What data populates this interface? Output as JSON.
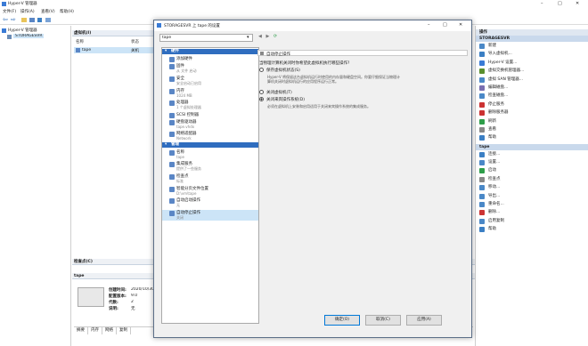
{
  "window": {
    "title": "Hyper-V 管理器"
  },
  "menu": [
    "文件(F)",
    "操作(A)",
    "查看(V)",
    "帮助(H)"
  ],
  "tree": {
    "root": "Hyper-V 管理器",
    "server": "STORAGESVR"
  },
  "vms": {
    "header": "虚拟机(I)",
    "columns": [
      "名称",
      "状态"
    ],
    "rows": [
      {
        "name": "tape",
        "state": "关机"
      }
    ]
  },
  "checkpoints": {
    "header": "检查点(C)"
  },
  "details": {
    "header": "tape",
    "fields": [
      {
        "label": "创建时间:",
        "value": "2020/10/30"
      },
      {
        "label": "配置版本:",
        "value": "9.0"
      },
      {
        "label": "代数:",
        "value": "2"
      },
      {
        "label": "说明:",
        "value": "无"
      }
    ],
    "tabs": [
      "摘要",
      "内存",
      "网络",
      "复制"
    ]
  },
  "actions": {
    "header": "操作",
    "server_group": "STORAGESVR",
    "server_items": [
      "新建",
      "导入虚拟机...",
      "Hyper-V 设置...",
      "虚拟交换机管理器...",
      "虚拟 SAN 管理器...",
      "编辑磁盘...",
      "检查磁盘...",
      "停止服务",
      "删除服务器",
      "刷新",
      "查看",
      "帮助"
    ],
    "vm_group": "tape",
    "vm_items": [
      "连接...",
      "设置...",
      "启动",
      "检查点",
      "移动...",
      "导出...",
      "重命名...",
      "删除...",
      "启用复制",
      "帮助"
    ],
    "colors": [
      "#4a88c7",
      "#3b7fc4",
      "#3a7bd5",
      "#5a8f2e",
      "#4a88c7",
      "#7a6fb0",
      "#4a88c7",
      "#cc3333",
      "#cc3333",
      "#2e9e4a",
      "#888888",
      "#3b7fc4",
      "#3b7fc4",
      "#4a88c7",
      "#2e9e4a",
      "#888888",
      "#4a88c7",
      "#4a88c7",
      "#4a88c7",
      "#cc3333",
      "#4a88c7",
      "#3b7fc4"
    ]
  },
  "dialog": {
    "title": "STORAGESVR 上 tape 的设置",
    "vm_select": "tape",
    "hw_section": "硬件",
    "mgmt_section": "管理",
    "items": [
      {
        "label": "添加硬件",
        "sub": ""
      },
      {
        "label": "固件",
        "sub": "从 文件 启动"
      },
      {
        "label": "安全",
        "sub": "安全启动已启用"
      },
      {
        "label": "内存",
        "sub": "1024 MB"
      },
      {
        "label": "处理器",
        "sub": "1 个虚拟处理器"
      },
      {
        "label": "SCSI 控制器",
        "sub": ""
      },
      {
        "label": "硬盘驱动器",
        "sub": "tape.vhdx"
      },
      {
        "label": "网络适配器",
        "sub": "Network"
      },
      {
        "label": "名称",
        "sub": "tape"
      },
      {
        "label": "集成服务",
        "sub": "提供了一些服务"
      },
      {
        "label": "检查点",
        "sub": "标准"
      },
      {
        "label": "智能分页文件位置",
        "sub": "D:\\vm\\tape"
      },
      {
        "label": "自动启动操作",
        "sub": "无"
      },
      {
        "label": "自动停止操作",
        "sub": "关闭"
      }
    ],
    "panel_title": "自动停止操作",
    "question": "当物理计算机关闭时你希望此虚拟机执行哪些操作?",
    "options": [
      {
        "label": "保存虚拟机状态(S)",
        "desc": "Hyper-V 将保留这台虚拟机运行时使用的内存量和硬盘空间。你要仔细保证当物理计算机关闭时虚拟机运行的应用程序运行正常。"
      },
      {
        "label": "关闭虚拟机(T)",
        "desc": ""
      },
      {
        "label": "关闭来宾操作系统(D)",
        "desc": "必须在虚拟机上安装和启用适用于关闭来宾操作系统的集成服务。"
      }
    ],
    "buttons": {
      "ok": "确定(O)",
      "cancel": "取消(C)",
      "apply": "应用(A)"
    }
  }
}
